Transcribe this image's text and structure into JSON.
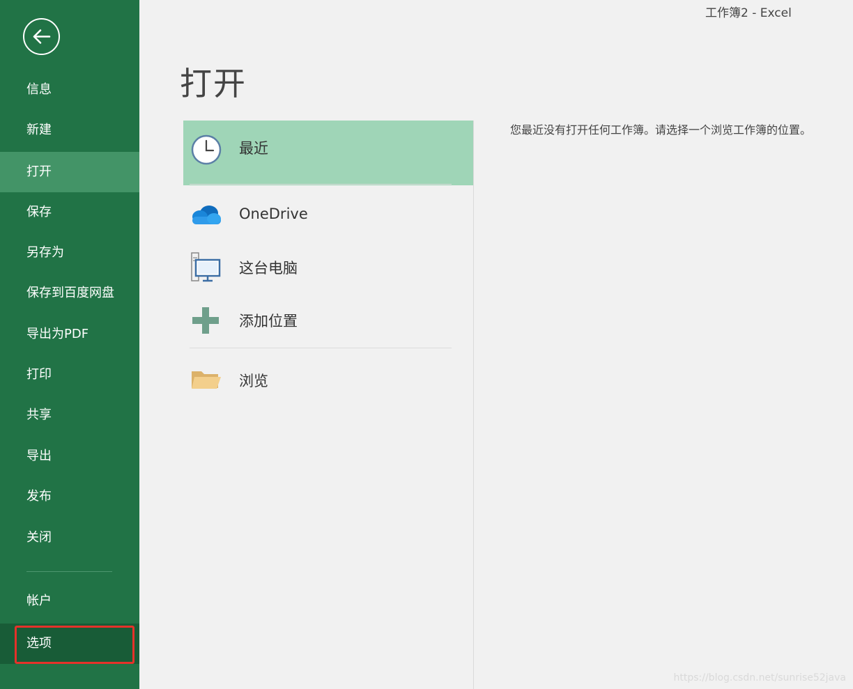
{
  "app": {
    "window_title": "工作簿2 - Excel"
  },
  "sidebar": {
    "back_icon": "arrow-left-circle-icon",
    "items": [
      {
        "id": "info",
        "label": "信息"
      },
      {
        "id": "new",
        "label": "新建"
      },
      {
        "id": "open",
        "label": "打开",
        "active": true
      },
      {
        "id": "save",
        "label": "保存"
      },
      {
        "id": "save-as",
        "label": "另存为"
      },
      {
        "id": "save-to-baidu",
        "label": "保存到百度网盘"
      },
      {
        "id": "export-pdf",
        "label": "导出为PDF"
      },
      {
        "id": "print",
        "label": "打印"
      },
      {
        "id": "share",
        "label": "共享"
      },
      {
        "id": "export",
        "label": "导出"
      },
      {
        "id": "publish",
        "label": "发布"
      },
      {
        "id": "close",
        "label": "关闭"
      },
      {
        "id": "account",
        "label": "帐户"
      },
      {
        "id": "options",
        "label": "选项",
        "highlighted": true
      }
    ],
    "colors": {
      "background": "#217346",
      "active": "#439467",
      "highlight_border": "#e6322a"
    }
  },
  "main": {
    "title": "打开",
    "locations": [
      {
        "id": "recent",
        "label": "最近",
        "icon": "clock-icon",
        "selected": true
      },
      {
        "id": "onedrive",
        "label": "OneDrive",
        "icon": "cloud-icon"
      },
      {
        "id": "this-pc",
        "label": "这台电脑",
        "icon": "computer-icon"
      },
      {
        "id": "add-place",
        "label": "添加位置",
        "icon": "plus-icon"
      },
      {
        "id": "browse",
        "label": "浏览",
        "icon": "folder-icon"
      }
    ],
    "empty_message": "您最近没有打开任何工作簿。请选择一个浏览工作簿的位置。",
    "colors": {
      "selected": "#9fd5b7"
    }
  },
  "watermark": "https://blog.csdn.net/sunrise52java"
}
